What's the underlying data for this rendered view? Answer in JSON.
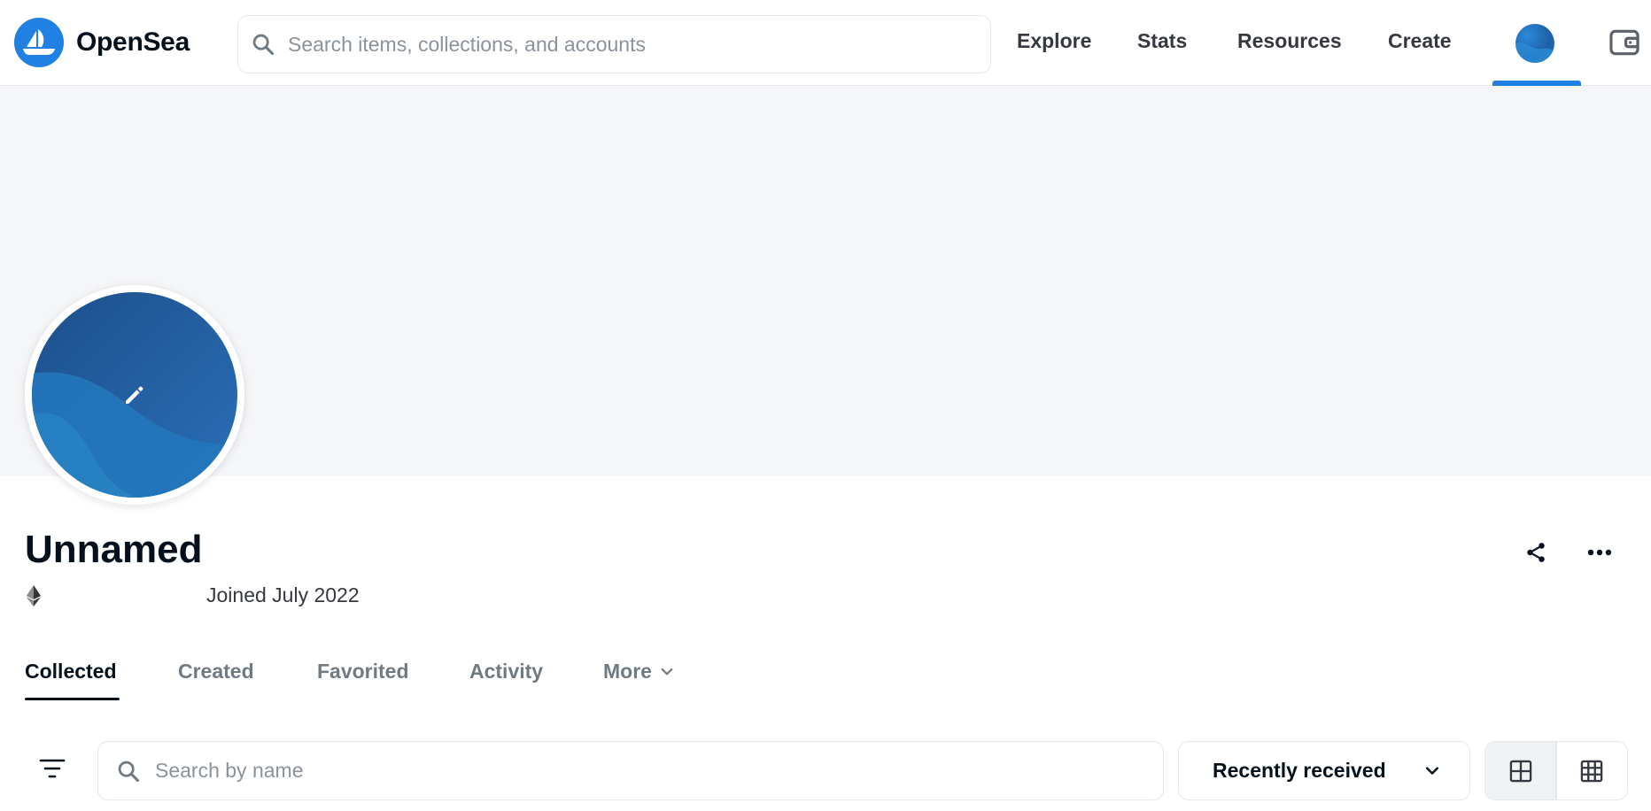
{
  "brand": {
    "name": "OpenSea",
    "color": "#2081e2"
  },
  "header": {
    "search_placeholder": "Search items, collections, and accounts",
    "nav": [
      {
        "label": "Explore"
      },
      {
        "label": "Stats"
      },
      {
        "label": "Resources"
      },
      {
        "label": "Create"
      }
    ],
    "icons": [
      "search-icon",
      "profile-avatar",
      "wallet-icon"
    ]
  },
  "profile": {
    "name": "Unnamed",
    "chain_icon": "ethereum-icon",
    "joined": "Joined July 2022",
    "actions": [
      "share-icon",
      "more-options-icon"
    ]
  },
  "tabs": [
    {
      "label": "Collected",
      "active": true
    },
    {
      "label": "Created",
      "active": false
    },
    {
      "label": "Favorited",
      "active": false
    },
    {
      "label": "Activity",
      "active": false
    },
    {
      "label": "More",
      "active": false
    }
  ],
  "filters": {
    "search_placeholder": "Search by name",
    "sort_selected": "Recently received",
    "view_modes": [
      {
        "icon": "large-grid-icon",
        "selected": true
      },
      {
        "icon": "small-grid-icon",
        "selected": false
      }
    ]
  }
}
